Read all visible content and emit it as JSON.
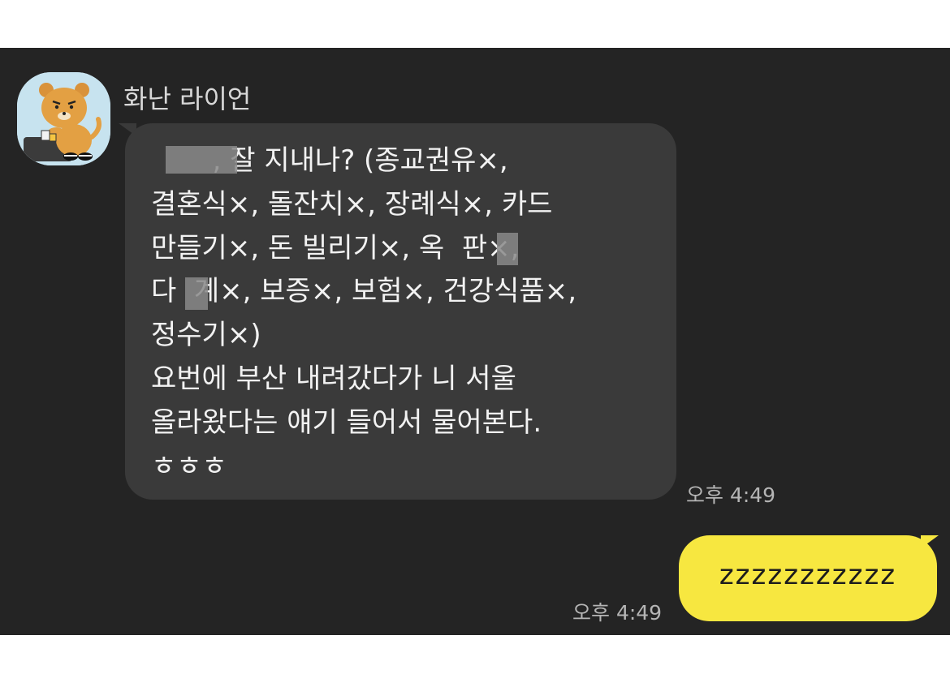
{
  "chat": {
    "sender": {
      "name": "화난 라이언",
      "avatar_icon": "ryan-character-icon"
    },
    "messages": [
      {
        "direction": "incoming",
        "text": "       , 잘 지내나? (종교권유×,\n결혼식×, 돌잔치×, 장례식×, 카드\n만들기×, 돈 빌리기×, 옥  판×,\n다  계×, 보증×, 보험×, 건강식품×,\n정수기×)\n요번에 부산 내려갔다가 니 서울\n올라왔다는 얘기 들어서 물어본다.\nㅎㅎㅎ",
        "time": "오후 4:49"
      },
      {
        "direction": "outgoing",
        "text": "zzzzzzzzzzz",
        "time": "오후 4:49"
      }
    ],
    "colors": {
      "background": "#242424",
      "incoming_bubble": "#3a3a3a",
      "outgoing_bubble": "#f7e740"
    }
  }
}
